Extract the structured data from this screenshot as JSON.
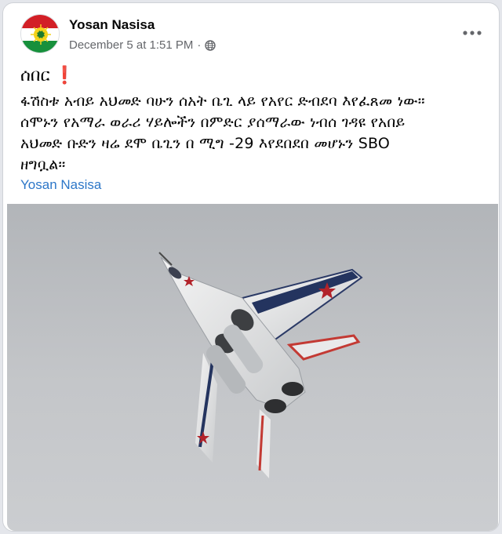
{
  "post": {
    "author_name": "Yosan Nasisa",
    "timestamp": "December 5 at 1:51 PM",
    "separator": "·",
    "privacy_icon": "globe-icon",
    "more_icon": "more-options-icon",
    "headline": "ሰበር",
    "headline_icon": "❗",
    "body_lines": [
      "ፋሽስቱ አብይ አህመድ ባሁን ሰአት ቤጊ ላይ የአየር ድብደባ እየፈጸመ ነው።",
      "ሰሞኑን የአማራ ወራሪ ሃይሎችን በምድር ያሰማራው ነብሰ ገዳዩ የአበይ",
      "አህመድ ቡድን ዛሬ ደሞ ቤጊን በ ሚግ -29 እየደበደበ መሆኑን SBO",
      "ዘግቧል።"
    ],
    "author_link": "Yosan Nasisa",
    "image_subject": "fighter-jet-photo"
  },
  "colors": {
    "link_blue": "#2d77c8",
    "text_primary": "#050505",
    "text_secondary": "#65676b",
    "flag_red": "#d21f26",
    "flag_green": "#17903c",
    "flag_yellow": "#f4d21a"
  }
}
